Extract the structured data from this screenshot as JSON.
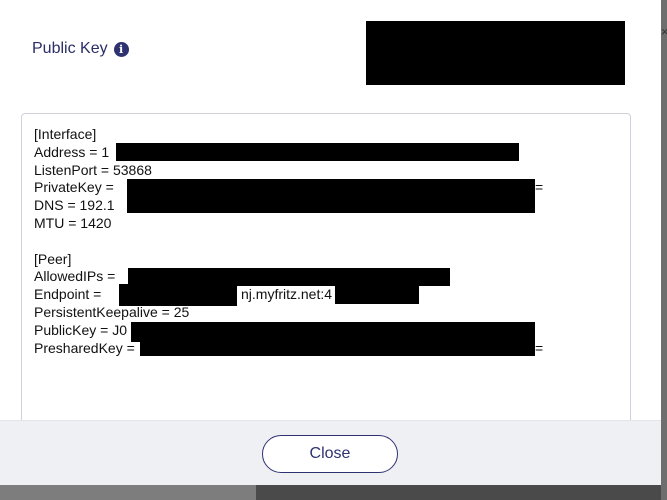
{
  "public_key": {
    "label": "Public Key",
    "info_icon": "i"
  },
  "config": {
    "lines": [
      "[Interface]",
      "Address = 1",
      "ListenPort = 53868",
      "PrivateKey =",
      "DNS = 192.1",
      "MTU = 1420",
      "",
      "[Peer]",
      "AllowedIPs =",
      "Endpoint = ",
      "PersistentKeepalive = 25",
      "PublicKey = J0",
      "PresharedKey = "
    ],
    "endpoint_fragment": "nj.myfritz.net:4",
    "private_key_tail": "=",
    "preshared_key_tail": "="
  },
  "footer": {
    "close_label": "Close"
  },
  "edge_mark": "×"
}
